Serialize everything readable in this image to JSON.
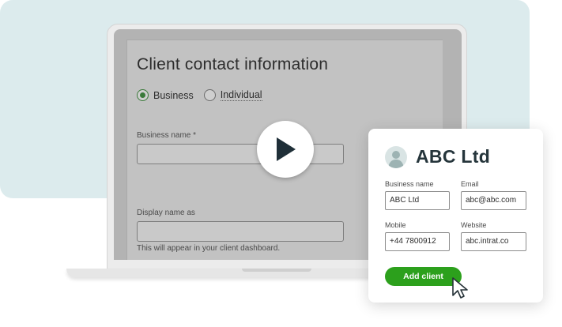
{
  "form": {
    "title": "Client contact information",
    "radio_options": [
      {
        "label": "Business",
        "checked": true
      },
      {
        "label": "Individual",
        "checked": false
      }
    ],
    "business_name_label": "Business name *",
    "display_name_label": "Display name as",
    "display_name_hint": "This will appear in your client dashboard."
  },
  "card": {
    "title": "ABC Ltd",
    "business_name": {
      "label": "Business name",
      "value": "ABC Ltd"
    },
    "email": {
      "label": "Email",
      "value": "abc@abc.com"
    },
    "mobile": {
      "label": "Mobile",
      "value": "+44 7800912"
    },
    "website": {
      "label": "Website",
      "value": "abc.intrat.co"
    },
    "add_button_label": "Add client"
  },
  "icons": {
    "play": "play-icon",
    "avatar": "person-avatar-icon",
    "cursor": "mouse-pointer-icon"
  },
  "colors": {
    "accent_green": "#2ca01c",
    "background_panel": "#dcebed",
    "play_triangle": "#1f2f38"
  }
}
